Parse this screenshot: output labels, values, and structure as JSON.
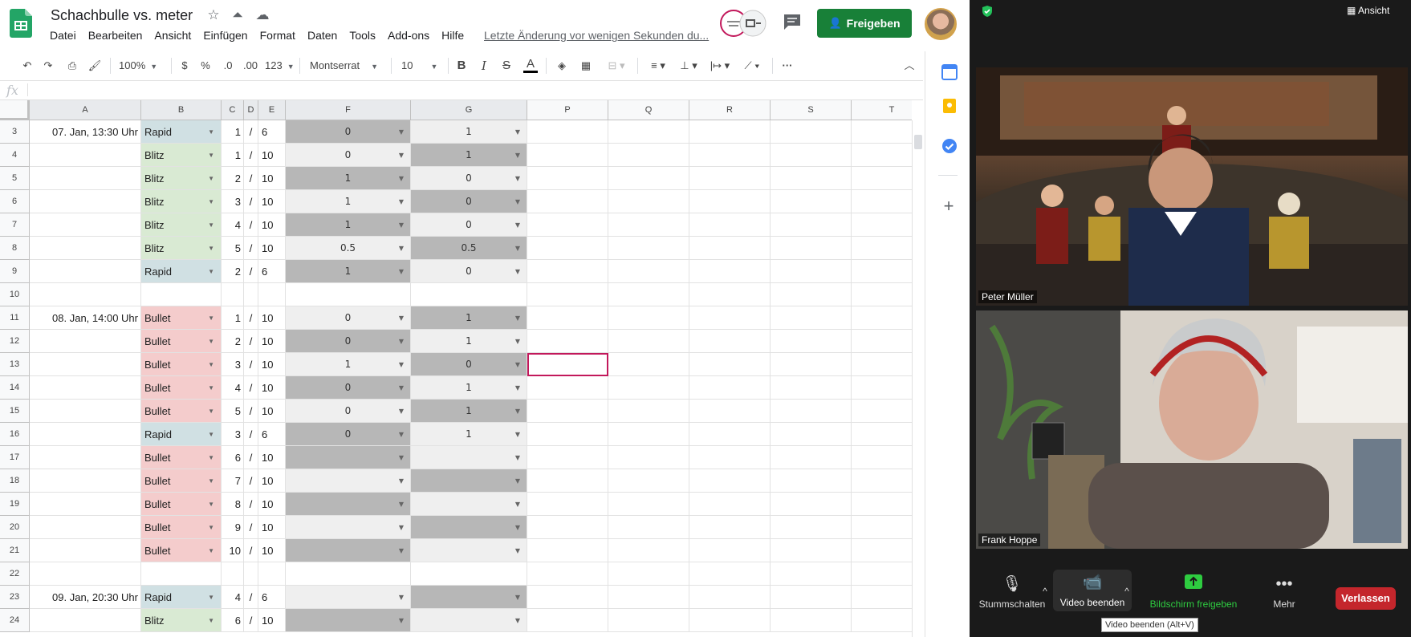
{
  "doc": {
    "title": "Schachbulle vs. meter",
    "menu": [
      "Datei",
      "Bearbeiten",
      "Ansicht",
      "Einfügen",
      "Format",
      "Daten",
      "Tools",
      "Add-ons",
      "Hilfe"
    ],
    "last_edit": "Letzte Änderung vor wenigen Sekunden du...",
    "share_label": "Freigeben"
  },
  "toolbar": {
    "zoom": "100%",
    "currency": "$",
    "percent": "%",
    "dec_less": ".0",
    "dec_more": ".00",
    "format_more": "123",
    "font": "Montserrat",
    "font_size": "10",
    "bold": "B",
    "italic": "I",
    "strike": "S",
    "text_color": "A",
    "more": "···"
  },
  "formula": {
    "fx": "fx",
    "value": ""
  },
  "columns": [
    "A",
    "B",
    "C",
    "D",
    "E",
    "F",
    "G",
    "P",
    "Q",
    "R",
    "S",
    "T"
  ],
  "rows": [
    {
      "n": "3",
      "date": "07. Jan, 13:30 Uhr",
      "mode": "Rapid",
      "cls": "rapid",
      "num": "1",
      "slash": "/",
      "tot": "6",
      "f": "0",
      "fs": "dark",
      "g": "1",
      "gs": "light"
    },
    {
      "n": "4",
      "date": "",
      "mode": "Blitz",
      "cls": "blitz",
      "num": "1",
      "slash": "/",
      "tot": "10",
      "f": "0",
      "fs": "light",
      "g": "1",
      "gs": "dark"
    },
    {
      "n": "5",
      "date": "",
      "mode": "Blitz",
      "cls": "blitz",
      "num": "2",
      "slash": "/",
      "tot": "10",
      "f": "1",
      "fs": "dark",
      "g": "0",
      "gs": "light"
    },
    {
      "n": "6",
      "date": "",
      "mode": "Blitz",
      "cls": "blitz",
      "num": "3",
      "slash": "/",
      "tot": "10",
      "f": "1",
      "fs": "light",
      "g": "0",
      "gs": "dark"
    },
    {
      "n": "7",
      "date": "",
      "mode": "Blitz",
      "cls": "blitz",
      "num": "4",
      "slash": "/",
      "tot": "10",
      "f": "1",
      "fs": "dark",
      "g": "0",
      "gs": "light"
    },
    {
      "n": "8",
      "date": "",
      "mode": "Blitz",
      "cls": "blitz",
      "num": "5",
      "slash": "/",
      "tot": "10",
      "f": "0.5",
      "fs": "light",
      "g": "0.5",
      "gs": "dark"
    },
    {
      "n": "9",
      "date": "",
      "mode": "Rapid",
      "cls": "rapid",
      "num": "2",
      "slash": "/",
      "tot": "6",
      "f": "1",
      "fs": "dark",
      "g": "0",
      "gs": "light"
    },
    {
      "n": "10",
      "date": "",
      "mode": "",
      "cls": "",
      "num": "",
      "slash": "",
      "tot": "",
      "f": "",
      "fs": "",
      "g": "",
      "gs": ""
    },
    {
      "n": "11",
      "date": "08. Jan, 14:00 Uhr",
      "mode": "Bullet",
      "cls": "bullet",
      "num": "1",
      "slash": "/",
      "tot": "10",
      "f": "0",
      "fs": "light",
      "g": "1",
      "gs": "dark"
    },
    {
      "n": "12",
      "date": "",
      "mode": "Bullet",
      "cls": "bullet",
      "num": "2",
      "slash": "/",
      "tot": "10",
      "f": "0",
      "fs": "dark",
      "g": "1",
      "gs": "light"
    },
    {
      "n": "13",
      "date": "",
      "mode": "Bullet",
      "cls": "bullet",
      "num": "3",
      "slash": "/",
      "tot": "10",
      "f": "1",
      "fs": "light",
      "g": "0",
      "gs": "dark"
    },
    {
      "n": "14",
      "date": "",
      "mode": "Bullet",
      "cls": "bullet",
      "num": "4",
      "slash": "/",
      "tot": "10",
      "f": "0",
      "fs": "dark",
      "g": "1",
      "gs": "light"
    },
    {
      "n": "15",
      "date": "",
      "mode": "Bullet",
      "cls": "bullet",
      "num": "5",
      "slash": "/",
      "tot": "10",
      "f": "0",
      "fs": "light",
      "g": "1",
      "gs": "dark"
    },
    {
      "n": "16",
      "date": "",
      "mode": "Rapid",
      "cls": "rapid",
      "num": "3",
      "slash": "/",
      "tot": "6",
      "f": "0",
      "fs": "dark",
      "g": "1",
      "gs": "light"
    },
    {
      "n": "17",
      "date": "",
      "mode": "Bullet",
      "cls": "bullet",
      "num": "6",
      "slash": "/",
      "tot": "10",
      "f": "",
      "fs": "dark",
      "g": "",
      "gs": "light"
    },
    {
      "n": "18",
      "date": "",
      "mode": "Bullet",
      "cls": "bullet",
      "num": "7",
      "slash": "/",
      "tot": "10",
      "f": "",
      "fs": "light",
      "g": "",
      "gs": "dark"
    },
    {
      "n": "19",
      "date": "",
      "mode": "Bullet",
      "cls": "bullet",
      "num": "8",
      "slash": "/",
      "tot": "10",
      "f": "",
      "fs": "dark",
      "g": "",
      "gs": "light"
    },
    {
      "n": "20",
      "date": "",
      "mode": "Bullet",
      "cls": "bullet",
      "num": "9",
      "slash": "/",
      "tot": "10",
      "f": "",
      "fs": "light",
      "g": "",
      "gs": "dark"
    },
    {
      "n": "21",
      "date": "",
      "mode": "Bullet",
      "cls": "bullet",
      "num": "10",
      "slash": "/",
      "tot": "10",
      "f": "",
      "fs": "dark",
      "g": "",
      "gs": "light"
    },
    {
      "n": "22",
      "date": "",
      "mode": "",
      "cls": "",
      "num": "",
      "slash": "",
      "tot": "",
      "f": "",
      "fs": "",
      "g": "",
      "gs": ""
    },
    {
      "n": "23",
      "date": "09. Jan, 20:30 Uhr",
      "mode": "Rapid",
      "cls": "rapid",
      "num": "4",
      "slash": "/",
      "tot": "6",
      "f": "",
      "fs": "light",
      "g": "",
      "gs": "dark"
    },
    {
      "n": "24",
      "date": "",
      "mode": "Blitz",
      "cls": "blitz",
      "num": "6",
      "slash": "/",
      "tot": "10",
      "f": "",
      "fs": "dark",
      "g": "",
      "gs": "light"
    }
  ],
  "zoom": {
    "view_label": "Ansicht",
    "participants": [
      {
        "name": "Peter Müller"
      },
      {
        "name": "Frank Hoppe"
      }
    ],
    "controls": {
      "mute": "Stummschalten",
      "video": "Video beenden",
      "share": "Bildschirm freigeben",
      "more": "Mehr",
      "leave": "Verlassen"
    },
    "tooltip": "Video beenden (Alt+V)"
  },
  "colors": {
    "share_green": "#188038",
    "rapid": "#d0e0e3",
    "blitz": "#d9ead3",
    "bullet": "#f4cccc",
    "res_light": "#efefef",
    "res_dark": "#b7b7b7",
    "selection": "#c2185b",
    "leave_red": "#c4262c"
  }
}
